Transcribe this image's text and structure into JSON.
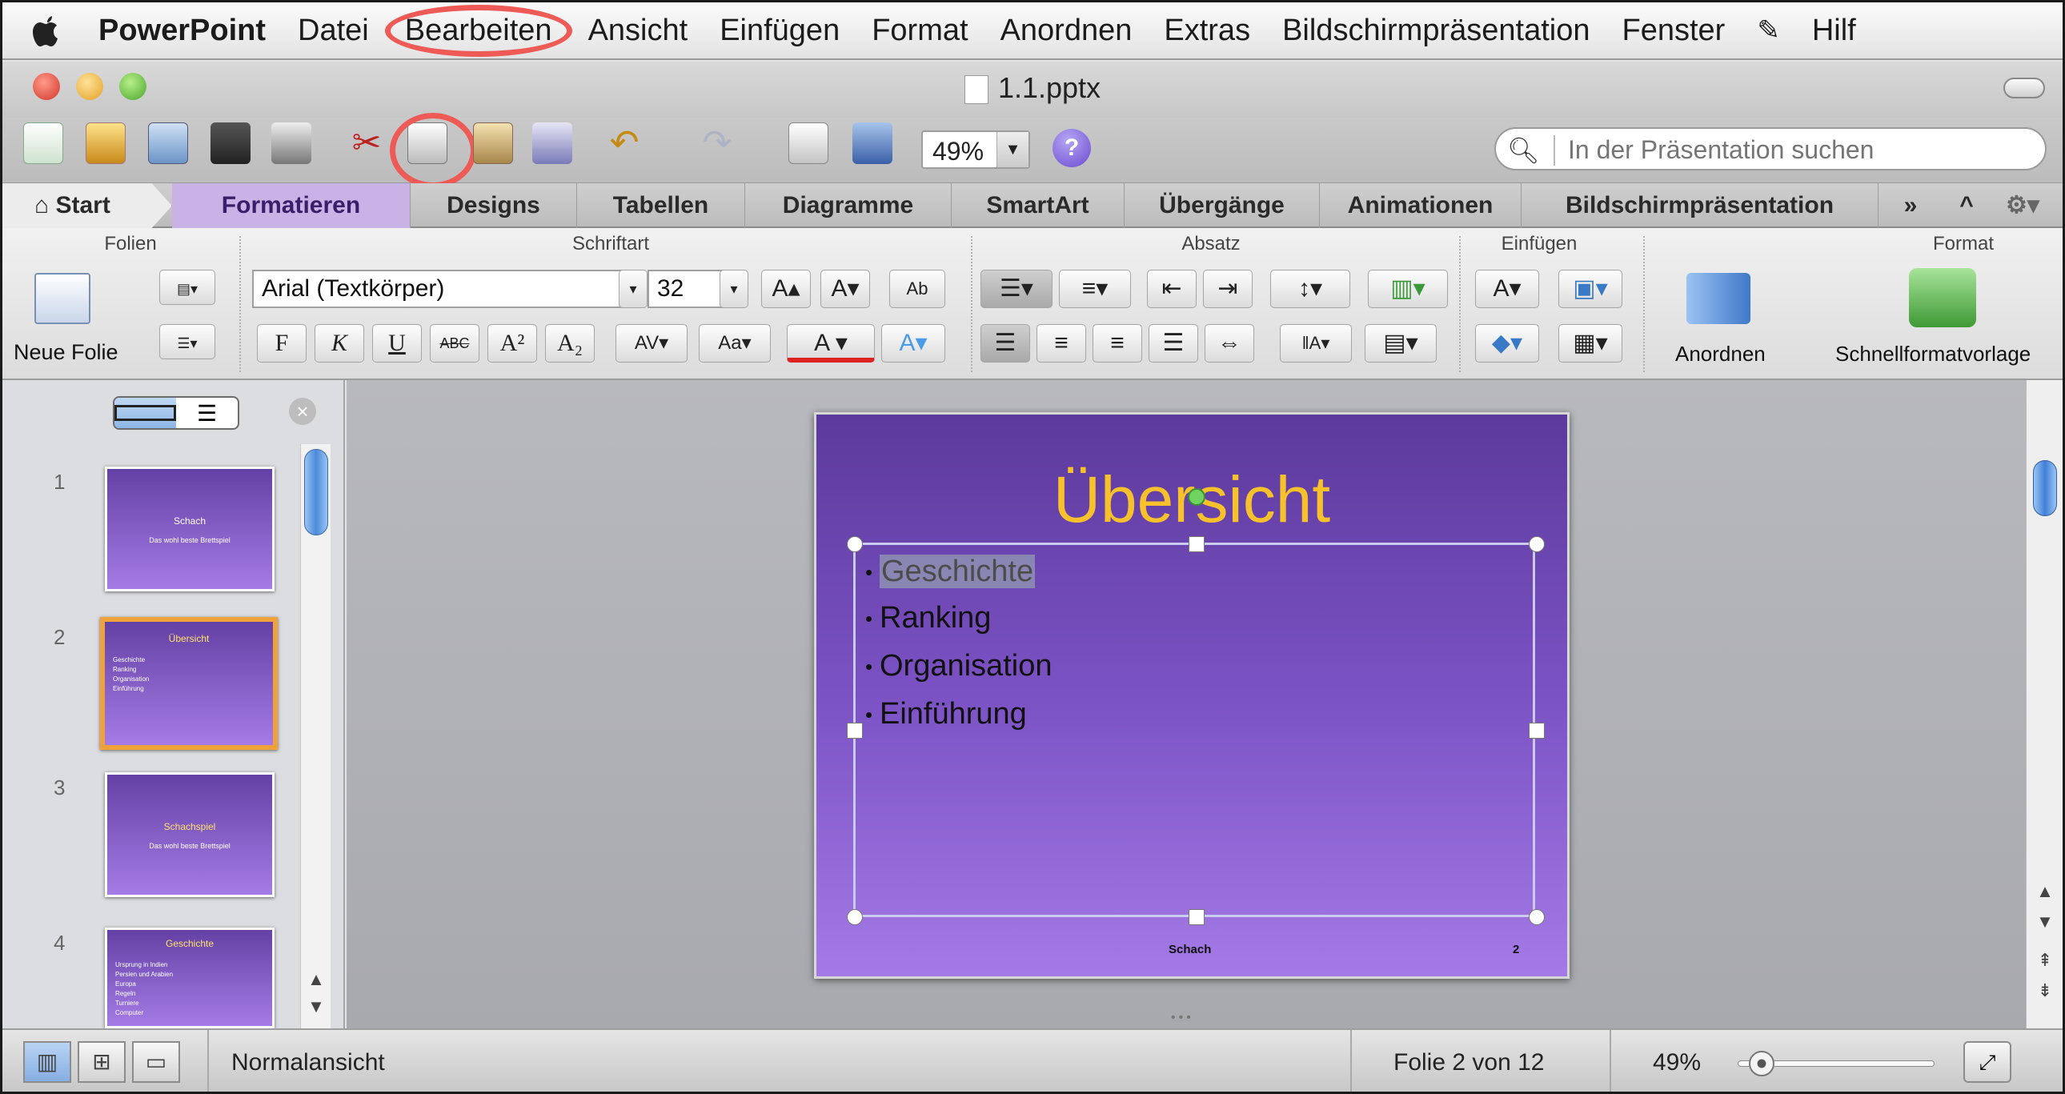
{
  "menubar": {
    "app": "PowerPoint",
    "items": [
      "Datei",
      "Bearbeiten",
      "Ansicht",
      "Einfügen",
      "Format",
      "Anordnen",
      "Extras",
      "Bildschirmpräsentation",
      "Fenster",
      "Hilf"
    ]
  },
  "window": {
    "title": "1.1.pptx"
  },
  "toolbar": {
    "zoom": "49%",
    "search_placeholder": "In der Präsentation suchen",
    "help": "?"
  },
  "ribbon": {
    "tabs": [
      "Start",
      "Formatieren",
      "Designs",
      "Tabellen",
      "Diagramme",
      "SmartArt",
      "Übergänge",
      "Animationen",
      "Bildschirmpräsentation"
    ],
    "groups": {
      "folien": "Folien",
      "schriftart": "Schriftart",
      "absatz": "Absatz",
      "einfuegen": "Einfügen",
      "format": "Format"
    },
    "new_slide": "Neue Folie",
    "font_name": "Arial (Textkörper)",
    "font_size": "32",
    "bold": "F",
    "italic": "K",
    "underline": "U",
    "strike": "ABC",
    "anordnen": "Anordnen",
    "quickstyle": "Schnellformatvorlage"
  },
  "slides_panel": {
    "thumbs": [
      {
        "num": "1",
        "title": "Schach",
        "sub": "Das wohl beste Brettspiel"
      },
      {
        "num": "2",
        "title": "Übersicht",
        "lines": [
          "Geschichte",
          "Ranking",
          "Organisation",
          "Einführung"
        ]
      },
      {
        "num": "3",
        "title": "Schachspiel",
        "sub": "Das wohl beste Brettspiel"
      },
      {
        "num": "4",
        "title": "Geschichte",
        "lines": [
          "Ursprung in Indien",
          "Persien und Arabien",
          "Europa",
          "Regeln",
          "Turniere",
          "Computer"
        ]
      }
    ]
  },
  "slide": {
    "title": "Übersicht",
    "bullets": [
      "Geschichte",
      "Ranking",
      "Organisation",
      "Einführung"
    ],
    "footer": "Schach",
    "page": "2"
  },
  "status": {
    "view": "Normalansicht",
    "slide_info": "Folie 2 von 12",
    "zoom": "49%"
  },
  "colors": {
    "highlight_circle": "#ee5a56",
    "slide_title": "#f6c12b",
    "selected_thumb": "#f0a23a"
  }
}
